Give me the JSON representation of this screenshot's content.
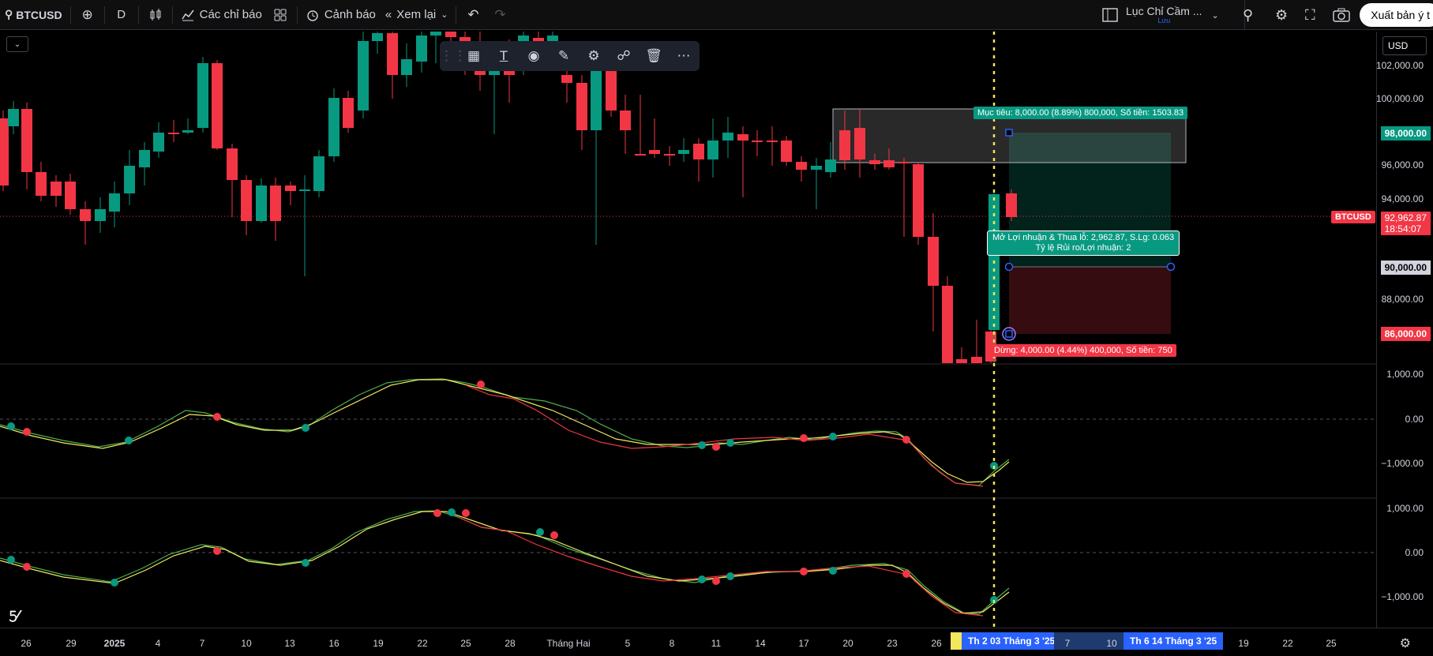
{
  "topbar": {
    "symbol": "BTCUSD",
    "interval": "D",
    "indicators_label": "Các chỉ báo",
    "alerts_label": "Cảnh báo",
    "replay_label": "Xem lại",
    "layout_name": "Lục Chỉ Cầm ...",
    "layout_status": "Lưu",
    "export_label": "Xuất bản ý t"
  },
  "icons": {
    "search": "search-icon",
    "add": "plus-circle-icon",
    "bars": "candles-icon",
    "indicators": "indicators-icon",
    "templates": "grid-icon",
    "alert": "alarm-clock-icon",
    "replay": "rewind-icon",
    "undo": "undo-icon",
    "redo": "redo-icon",
    "layout": "layout-icon",
    "zoom": "zoom-icon",
    "settings": "gear-icon",
    "fullscreen": "fullscreen-icon",
    "camera": "camera-icon"
  },
  "floating_toolbar": {
    "items": [
      "drag-handle-icon",
      "template-icon",
      "text-icon",
      "fill-icon",
      "line-color-icon",
      "settings-icon",
      "lock-icon",
      "trash-icon",
      "more-icon"
    ]
  },
  "currency": "USD",
  "price_axis": {
    "labels": [
      "102,000.00",
      "100,000.00",
      "96,000.00",
      "94,000.00",
      "88,000.00"
    ],
    "target_tag": "98,000.00",
    "entry_tag": "90,000.00",
    "stop_tag": "86,000.00",
    "current_price": "92,962.87",
    "countdown": "18:54:07",
    "symbol_tag": "BTCUSD"
  },
  "osc_axis_1": {
    "labels": [
      "1,000.00",
      "0.00",
      "−1,000.00"
    ]
  },
  "osc_axis_2": {
    "labels": [
      "1,000.00",
      "0.00",
      "−1,000.00"
    ]
  },
  "position_tool": {
    "target_label": "Mục tiêu: 8,000.00 (8.89%) 800,000, Số tiền: 1503.83",
    "pnl_label": "Mở Lợi nhuận & Thua lỗ: 2,962.87, S.Lg: 0.063",
    "ratio_label": "Tỷ lệ Rủi ro/Lợi nhuận: 2",
    "stop_label": "Dừng: 4,000.00 (4.44%) 400,000, Số tiền: 750"
  },
  "x_axis": {
    "labels": [
      "26",
      "29",
      "2025",
      "4",
      "7",
      "10",
      "13",
      "16",
      "19",
      "22",
      "25",
      "28",
      "Tháng Hai",
      "5",
      "8",
      "11",
      "14",
      "17",
      "20",
      "23",
      "26",
      "7",
      "10",
      "19",
      "22",
      "25"
    ],
    "tag_1": "Th 2 03 Tháng 3 '25",
    "tag_2": "Th 6 14 Tháng 3 '25"
  },
  "colors": {
    "up": "#089981",
    "down": "#f23645",
    "osc_fast": "#f2e85c",
    "osc_slow_green": "#4caf50",
    "osc_slow_red": "#f23645"
  }
}
